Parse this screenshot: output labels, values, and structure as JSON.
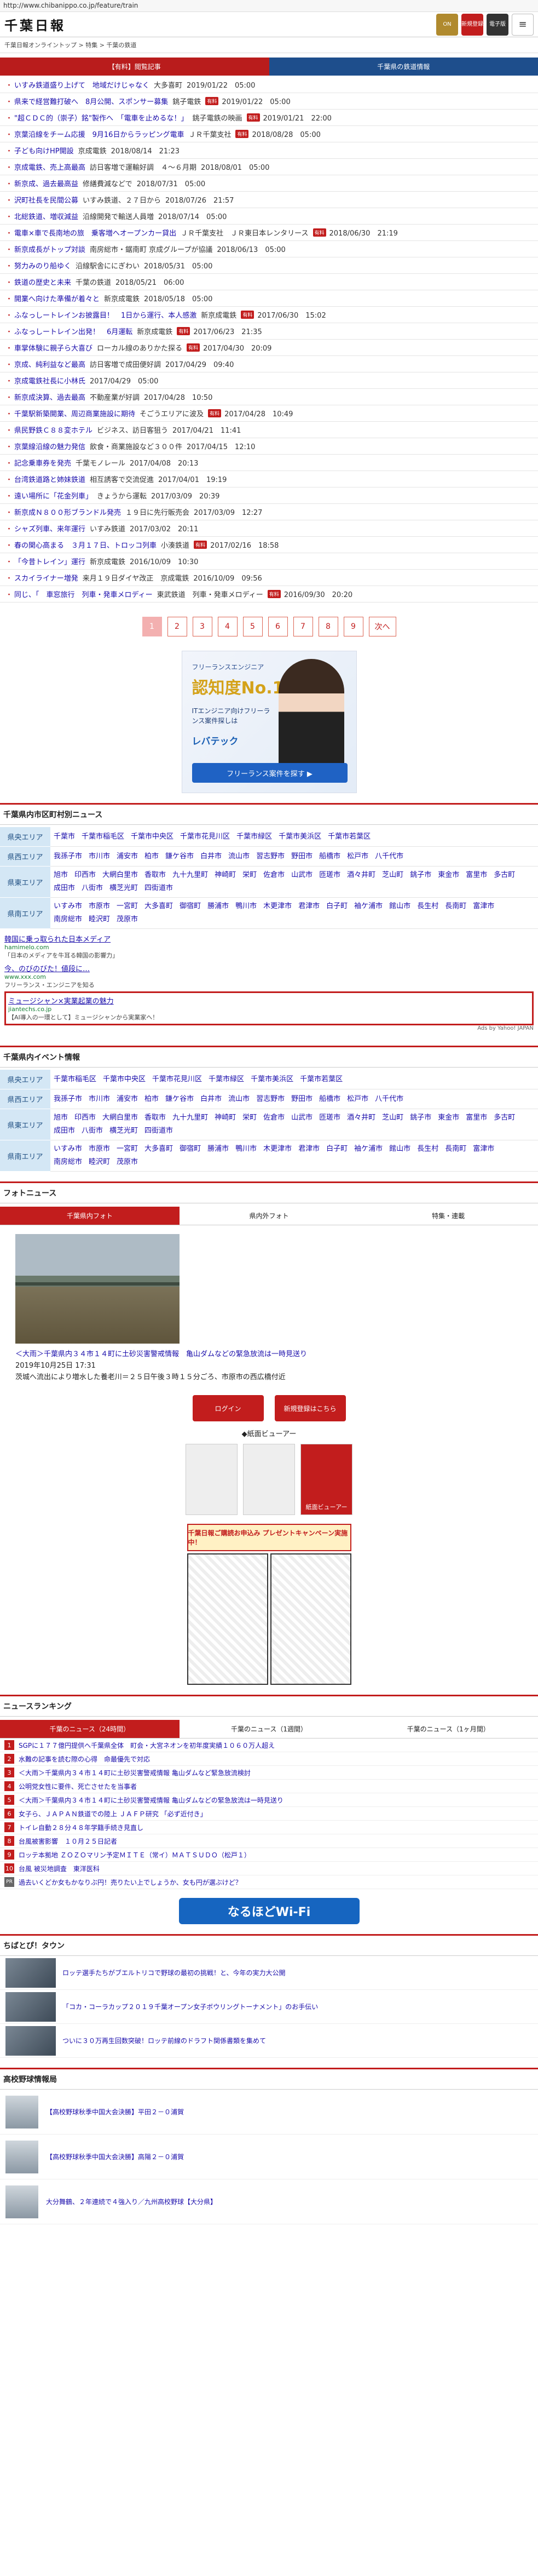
{
  "url": "http://www.chibanippo.co.jp/feature/train",
  "header": {
    "logo": "千葉日報",
    "lock_label": "ON",
    "register_label": "新規登録",
    "edition_label": "電子版",
    "menu_label": "≡"
  },
  "breadcrumb": "千葉日報オンライントップ > 特集 > 千葉の鉄道",
  "tabs": {
    "paid": "【有料】閲覧記事",
    "free": "千葉県の鉄道情報"
  },
  "articles": [
    {
      "title": "いすみ鉄道盛り上げて　地域だけじゃなく",
      "source": "大多喜町",
      "paid": false,
      "time": "2019/01/22　05:00"
    },
    {
      "title": "県来で経営難打破へ　8月公開、スポンサー募集",
      "source": "銚子電鉄",
      "paid": true,
      "time": "2019/01/22　05:00"
    },
    {
      "title": "\"超ＣＤＣ的（崇子）銘\"製作へ　「電車を止めるな！」",
      "source": "銚子電鉄の映画",
      "paid": true,
      "time": "2019/01/21　22:00"
    },
    {
      "title": "京葉沿線をチーム応援　9月16日からラッピング電車",
      "source": "ＪＲ千葉支社",
      "paid": true,
      "time": "2018/08/28　05:00"
    },
    {
      "title": "子ども向けHP開設",
      "source": "京成電鉄",
      "paid": false,
      "time": "2018/08/14　21:23"
    },
    {
      "title": "京成電鉄、売上高最高",
      "source": "訪日客増で運輸好調　４～６月期",
      "paid": false,
      "time": "2018/08/01　05:00"
    },
    {
      "title": "新京成、過去最高益",
      "source": "修繕費減などで",
      "paid": false,
      "time": "2018/07/31　05:00"
    },
    {
      "title": "沢町社長を民間公募",
      "source": "いすみ鉄道、２７日から",
      "paid": false,
      "time": "2018/07/26　21:57"
    },
    {
      "title": "北総鉄道、増収減益",
      "source": "沿線開発で輸送人員増",
      "paid": false,
      "time": "2018/07/14　05:00"
    },
    {
      "title": "電車×車で長南地の旅　乗客増へオープンカー貸出",
      "source": "ＪＲ千葉支社　ＪＲ東日本レンタリース",
      "paid": true,
      "time": "2018/06/30　21:19"
    },
    {
      "title": "新京成長がトップ対談",
      "source": "南房総市・鋸南町 京成グループが協議",
      "paid": false,
      "time": "2018/06/13　05:00"
    },
    {
      "title": "努力みのり船ゆく",
      "source": "沿線駅舎ににぎわい",
      "paid": false,
      "time": "2018/05/31　05:00"
    },
    {
      "title": "鉄道の歴史と未来",
      "source": "千葉の鉄道",
      "paid": false,
      "time": "2018/05/21　06:00"
    },
    {
      "title": "開業へ向けた準備が着々と",
      "source": "新京成電鉄",
      "paid": false,
      "time": "2018/05/18　05:00"
    },
    {
      "title": "ふなっしートレインお披露目！　1日から運行、本人感激",
      "source": "新京成電鉄",
      "paid": true,
      "time": "2017/06/30　15:02"
    },
    {
      "title": "ふなっしートレイン出発！　6月運転",
      "source": "新京成電鉄",
      "paid": true,
      "time": "2017/06/23　21:35"
    },
    {
      "title": "車掌体験に親子ら大喜び",
      "source": "ローカル線のありかた探る",
      "paid": true,
      "time": "2017/04/30　20:09"
    },
    {
      "title": "京成、純利益など最高",
      "source": "訪日客増で成田便好調",
      "paid": false,
      "time": "2017/04/29　09:40"
    },
    {
      "title": "京成電鉄社長に小林氏",
      "source": "",
      "paid": false,
      "time": "2017/04/29　05:00"
    },
    {
      "title": "新京成決算、過去最高",
      "source": "不動産業が好調",
      "paid": false,
      "time": "2017/04/28　10:50"
    },
    {
      "title": "千葉駅新築開業、周辺商業施設に期待",
      "source": "そごうエリアに波及",
      "paid": true,
      "time": "2017/04/28　10:49"
    },
    {
      "title": "県民野鉄Ｃ８８変ホテル",
      "source": "ビジネス、訪日客狙う",
      "paid": false,
      "time": "2017/04/21　11:41"
    },
    {
      "title": "京葉線沿線の魅力発信",
      "source": "飲食・商業施設など３００件",
      "paid": false,
      "time": "2017/04/15　12:10"
    },
    {
      "title": "記念乗車券を発売",
      "source": "千葉モノレール",
      "paid": false,
      "time": "2017/04/08　20:13"
    },
    {
      "title": "台湾鉄道路と姉妹鉄道",
      "source": "相互誘客で交流促進",
      "paid": false,
      "time": "2017/04/01　19:19"
    },
    {
      "title": "遠い場所に「花金列車」",
      "source": "きょうから運転",
      "paid": false,
      "time": "2017/03/09　20:39"
    },
    {
      "title": "新京成Ｎ８００形ブランドル発売",
      "source": "１９日に先行販売会",
      "paid": false,
      "time": "2017/03/09　12:27"
    },
    {
      "title": "シャズ列車、来年運行",
      "source": "いすみ鉄道",
      "paid": false,
      "time": "2017/03/02　20:11"
    },
    {
      "title": "春の関心高まる　３月１７日、トロッコ列車",
      "source": "小湊鉄道",
      "paid": true,
      "time": "2017/02/16　18:58"
    },
    {
      "title": "「今昔トレイン」運行",
      "source": "新京成電鉄",
      "paid": false,
      "time": "2016/10/09　10:30"
    },
    {
      "title": "スカイライナー増発",
      "source": "来月１９日ダイヤ改正　京成電鉄",
      "paid": false,
      "time": "2016/10/09　09:56"
    },
    {
      "title": "同じ、「　車窓旅行　列車・発車メロディー",
      "source": "東武鉄道　列車・発車メロディー",
      "paid": true,
      "time": "2016/09/30　20:20"
    }
  ],
  "pager": {
    "pages": [
      "1",
      "2",
      "3",
      "4",
      "5",
      "6",
      "7",
      "8",
      "9"
    ],
    "current": "1",
    "next": "次へ"
  },
  "ad": {
    "line1": "フリーランスエンジニア",
    "no1": "認知度No.1",
    "line2": "ITエンジニア向けフリーランス案件探しは",
    "brand": "レバテック",
    "cta": "フリーランス案件を探す ▶"
  },
  "areas_title": "千葉県内市区町村別ニュース",
  "areas": [
    {
      "label": "県央エリア",
      "items": [
        "千葉市",
        "千葉市稲毛区",
        "千葉市中央区",
        "千葉市花見川区",
        "千葉市緑区",
        "千葉市美浜区",
        "千葉市若葉区"
      ]
    },
    {
      "label": "県西エリア",
      "items": [
        "我孫子市",
        "市川市",
        "浦安市",
        "柏市",
        "鎌ケ谷市",
        "白井市",
        "流山市",
        "習志野市",
        "野田市",
        "船橋市",
        "松戸市",
        "八千代市"
      ]
    },
    {
      "label": "県東エリア",
      "items": [
        "旭市",
        "印西市",
        "大網白里市",
        "香取市",
        "九十九里町",
        "神崎町",
        "栄町",
        "佐倉市",
        "山武市",
        "匝瑳市",
        "酒々井町",
        "芝山町",
        "銚子市",
        "東金市",
        "富里市",
        "多古町",
        "成田市",
        "八街市",
        "横芝光町",
        "四街道市"
      ]
    },
    {
      "label": "県南エリア",
      "items": [
        "いすみ市",
        "市原市",
        "一宮町",
        "大多喜町",
        "御宿町",
        "勝浦市",
        "鴨川市",
        "木更津市",
        "君津市",
        "白子町",
        "袖ケ浦市",
        "館山市",
        "長生村",
        "長南町",
        "富津市",
        "南房総市",
        "睦沢町",
        "茂原市"
      ]
    }
  ],
  "yahoo_ad": {
    "title1": "韓国に乗っ取られた日本メディア",
    "url1": "hamimelo.com",
    "desc1": "「日本のメディアを牛耳る韓国の影響力」",
    "title2": "今、のびのびた！値段に…",
    "url2": "www.xxx.com",
    "desc2": "フリーランス・エンジニアを知る",
    "title3": "ミュージシャン×実業起業の魅力",
    "url3": "jiantechs.co.jp",
    "desc3": "【AI導入の一環として】ミュージシャンから実業家へ！",
    "by": "Ads by Yahoo! JAPAN"
  },
  "events_title": "千葉県内イベント情報",
  "event_areas": [
    {
      "label": "県央エリア",
      "items": [
        "千葉市稲毛区",
        "千葉市中央区",
        "千葉市花見川区",
        "千葉市緑区",
        "千葉市美浜区",
        "千葉市若葉区"
      ]
    },
    {
      "label": "県西エリア",
      "items": [
        "我孫子市",
        "市川市",
        "浦安市",
        "柏市",
        "鎌ケ谷市",
        "白井市",
        "流山市",
        "習志野市",
        "野田市",
        "船橋市",
        "松戸市",
        "八千代市"
      ]
    },
    {
      "label": "県東エリア",
      "items": [
        "旭市",
        "印西市",
        "大網白里市",
        "香取市",
        "九十九里町",
        "神崎町",
        "栄町",
        "佐倉市",
        "山武市",
        "匝瑳市",
        "酒々井町",
        "芝山町",
        "銚子市",
        "東金市",
        "富里市",
        "多古町",
        "成田市",
        "八街市",
        "横芝光町",
        "四街道市"
      ]
    },
    {
      "label": "県南エリア",
      "items": [
        "いすみ市",
        "市原市",
        "一宮町",
        "大多喜町",
        "御宿町",
        "勝浦市",
        "鴨川市",
        "木更津市",
        "君津市",
        "白子町",
        "袖ケ浦市",
        "館山市",
        "長生村",
        "長南町",
        "富津市",
        "南房総市",
        "睦沢町",
        "茂原市"
      ]
    }
  ],
  "photo_title": "フォトニュース",
  "photo_tabs": [
    "千葉県内フォト",
    "県内外フォト",
    "特集・連載"
  ],
  "photo_caption_link": "＜大雨＞千葉県内３４市１４町に土砂災害警戒情報　亀山ダムなどの緊急放流は一時見送り",
  "photo_caption_time": "2019年10月25日 17:31",
  "photo_caption_sub": "茨城へ流出により増水した養老川＝２５日午後３時１５分ごろ、市原市の西広橋付近",
  "login_label": "ログイン",
  "newreg_label": "新規登録はこちら",
  "paper_link": "◆紙面ビューアー",
  "paper_label": "紙面ビューアー",
  "promo_label": "千葉日報ご購読お申込み プレゼントキャンペーン実施中！",
  "ranking_title": "ニュースランキング",
  "rank_tabs": [
    "千葉のニュース（24時間）",
    "千葉のニュース（1週間）",
    "千葉のニュース（1ヶ月間）"
  ],
  "ranking": [
    {
      "n": "1",
      "t": "SGPに１７７億円提供へ千葉県全体　町会・大宮ネオンを初年度実績１０６０万人超え"
    },
    {
      "n": "2",
      "t": "水難の記事を読む際の心得　命最優先で対応"
    },
    {
      "n": "3",
      "t": "＜大雨＞千葉県内３４市１４町に土砂災害警戒情報 亀山ダムなど緊急放流検討"
    },
    {
      "n": "4",
      "t": "公明党女性に要件、死亡させたを当事者"
    },
    {
      "n": "5",
      "t": "＜大雨＞千葉県内３４市１４町に土砂災害警戒情報 亀山ダムなどの緊急放流は一時見送り"
    },
    {
      "n": "6",
      "t": "女子ら、ＪＡＰＡＮ鉄道での陸上 ＪＡＦＰ研究 「必ず近付き」"
    },
    {
      "n": "7",
      "t": "トイレ自動２８分４８年学籍手続き見直し"
    },
    {
      "n": "8",
      "t": "台風被害影響　１０月２５日記者"
    },
    {
      "n": "9",
      "t": "ロッテ本拠地 ＺＯＺＯマリン予定ＭＩＴＥ（常イ）ＭＡＴＳＵＤＯ（松戸１）"
    },
    {
      "n": "10",
      "t": "台風 被災地調査　東洋医科"
    },
    {
      "n": "PR",
      "t": "過去いくどか女もかなりぶ円！売りたい上でしょうか、女も円が選ぶけど？"
    }
  ],
  "wifi_label": "なるほどWi-Fi",
  "town_title": "ちばとぴ！タウン",
  "town": [
    "ロッテ選手たちがブエルトリコで野球の最初の挑戦！と、今年の実力大公開",
    "「コカ・コーラカップ２０１９千葉オープン女子ボウリングトーナメント」のお手伝い",
    "ついに３０万再生回数突破！ロッテ前線のドラフト関係書類を集めて"
  ],
  "hs_title": "高校野球情報局",
  "hs": [
    "【高校野球秋季中国大会決勝】平田２－０浦賀",
    "【高校野球秋季中国大会決勝】高陽２－０浦賀",
    "大分舞鶴、２年連続で４強入り／九州高校野球【大分県】"
  ]
}
